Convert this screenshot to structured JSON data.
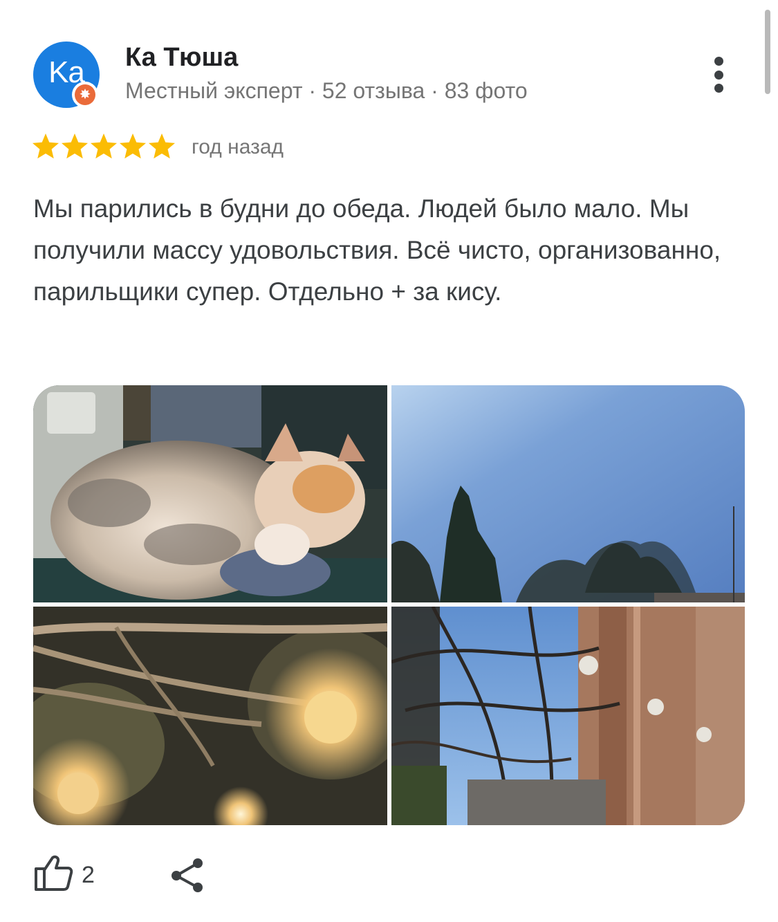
{
  "review": {
    "author": {
      "initials": "Ka",
      "name": "Ка Тюша",
      "meta": "Местный эксперт · 52 отзыва · 83 фото",
      "avatar_color": "#1a7ee0",
      "badge_color": "#ea6b3a",
      "badge_glyph": "✸"
    },
    "rating": 5,
    "rating_max": 5,
    "star_color": "#fbbc04",
    "date": "год назад",
    "text": "Мы парились в будни до обеда. Людей было мало. Мы получили массу удовольствия. Всё чисто, организованно, парильщики супер. Отдельно + за кису.",
    "photos": [
      {
        "subject": "cat-sleeping"
      },
      {
        "subject": "blue-sky-with-trees"
      },
      {
        "subject": "bathhouse-lamps-and-branches"
      },
      {
        "subject": "trees-and-brick-building"
      }
    ],
    "likes": "2",
    "icons": {
      "more": "more-vertical-icon",
      "like": "thumbs-up-icon",
      "share": "share-icon"
    }
  }
}
